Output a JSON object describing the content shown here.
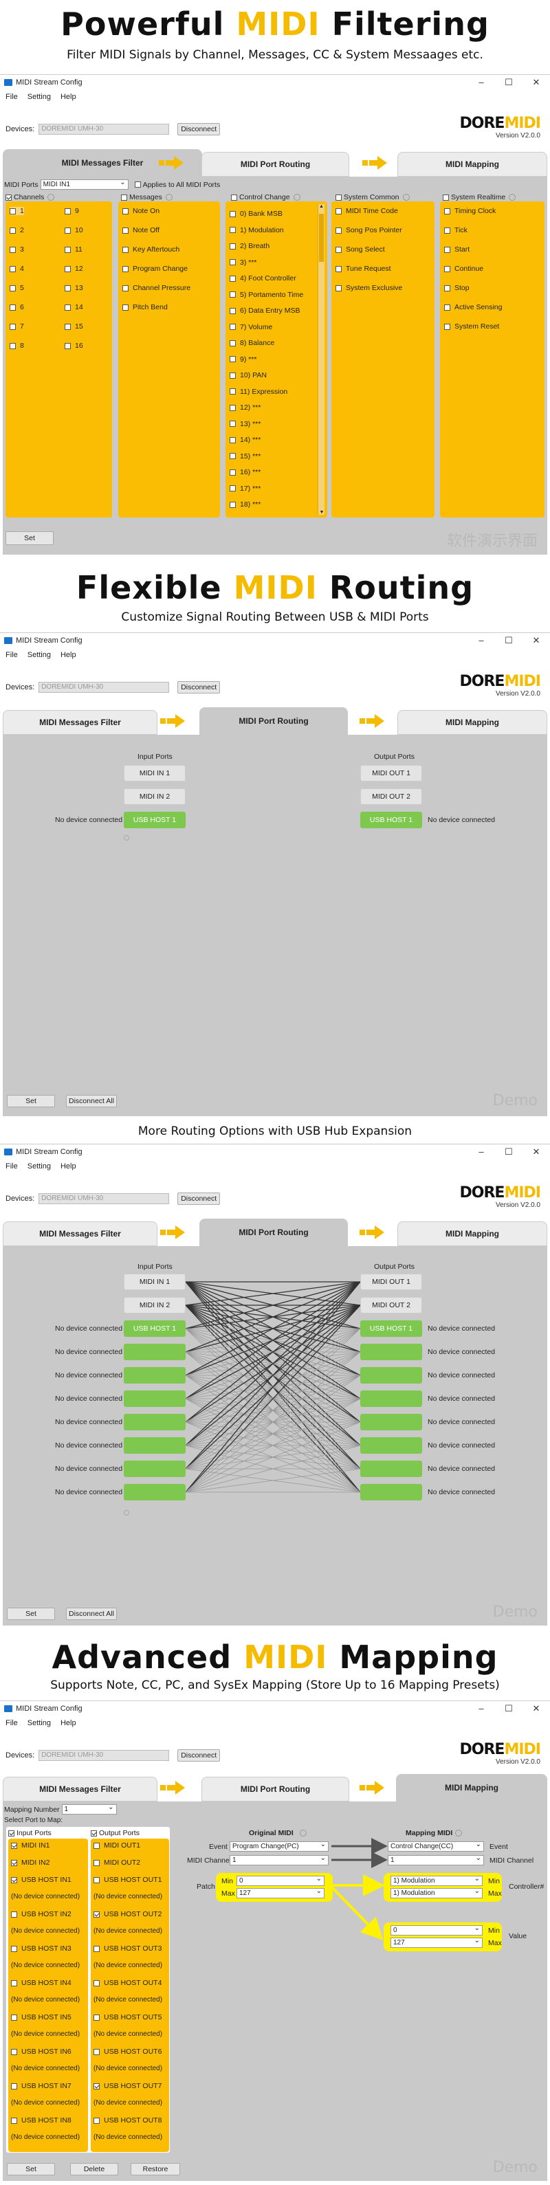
{
  "app": {
    "window_title": "MIDI Stream Config",
    "menu": [
      "File",
      "Setting",
      "Help"
    ],
    "devices_label": "Devices:",
    "device_name": "DOREMIDI UMH-30",
    "disconnect_label": "Disconnect",
    "logo_pre": "DORE",
    "logo_post": "MIDI",
    "version": "Version V2.0.0",
    "tabs": [
      "MIDI Messages Filter",
      "MIDI Port Routing",
      "MIDI Mapping"
    ]
  },
  "colors": {
    "accent": "#fbbd04",
    "green": "#7ec850",
    "yellow": "#fff200"
  },
  "section1": {
    "title_pre": "Powerful ",
    "title_hl": "MIDI",
    "title_post": " Filtering",
    "subtitle": "Filter MIDI Signals by Channel, Messages, CC & System Messaages etc.",
    "midi_ports_label": "MIDI Ports",
    "midi_ports_value": "MIDI IN1",
    "apply_all_label": "Applies to All MIDI Ports",
    "columns": {
      "channels": "Channels",
      "messages": "Messages",
      "control_change": "Control Change",
      "system_common": "System Common",
      "system_realtime": "System Realtime"
    },
    "channels": [
      "1",
      "2",
      "3",
      "4",
      "5",
      "6",
      "7",
      "8",
      "9",
      "10",
      "11",
      "12",
      "13",
      "14",
      "15",
      "16"
    ],
    "messages": [
      "Note On",
      "Note Off",
      "Key Aftertouch",
      "Program Change",
      "Channel Pressure",
      "Pitch Bend"
    ],
    "cc": [
      "0) Bank MSB",
      "1) Modulation",
      "2) Breath",
      "3) ***",
      "4) Foot Controller",
      "5) Portamento Time",
      "6) Data Entry MSB",
      "7) Volume",
      "8) Balance",
      "9) ***",
      "10) PAN",
      "11) Expression",
      "12) ***",
      "13) ***",
      "14) ***",
      "15) ***",
      "16) ***",
      "17) ***",
      "18) ***"
    ],
    "system_common": [
      "MIDI Time Code",
      "Song Pos Pointer",
      "Song Select",
      "Tune Request",
      "System Exclusive"
    ],
    "system_realtime": [
      "Timing Clock",
      "Tick",
      "Start",
      "Continue",
      "Stop",
      "Active Sensing",
      "System Reset"
    ],
    "set_label": "Set",
    "watermark": "软件演示界面"
  },
  "section2": {
    "title_pre": "Flexible ",
    "title_hl": "MIDI",
    "title_post": " Routing",
    "subtitle": "Customize Signal Routing Between USB & MIDI Ports",
    "input_ports_label": "Input Ports",
    "output_ports_label": "Output Ports",
    "inputs": [
      "MIDI IN 1",
      "MIDI IN 2",
      "USB HOST 1"
    ],
    "outputs": [
      "MIDI OUT 1",
      "MIDI OUT 2",
      "USB HOST 1"
    ],
    "no_device": "No device connected",
    "set_label": "Set",
    "disconnect_all_label": "Disconnect All",
    "watermark": "Demo"
  },
  "section3": {
    "heading": "More Routing Options with USB Hub Expansion",
    "input_ports_label": "Input Ports",
    "output_ports_label": "Output Ports",
    "inputs": [
      "MIDI IN 1",
      "MIDI IN 2",
      "USB HOST 1"
    ],
    "outputs": [
      "MIDI OUT 1",
      "MIDI OUT 2",
      "USB HOST 1"
    ],
    "no_device": "No device connected",
    "set_label": "Set",
    "disconnect_all_label": "Disconnect All",
    "watermark": "Demo"
  },
  "section4": {
    "title_pre": "Advanced ",
    "title_hl": "MIDI",
    "title_post": " Mapping",
    "subtitle": "Supports Note, CC, PC, and SysEx Mapping (Store Up to 16 Mapping Presets)",
    "mapping_number_label": "Mapping Number",
    "mapping_number_value": "1",
    "select_port_label": "Select Port to Map:",
    "input_ports_label": "Input Ports",
    "output_ports_label": "Output Ports",
    "input_list": [
      "MIDI IN1",
      "MIDI IN2",
      "USB HOST IN1",
      "(No device connected)",
      "USB HOST IN2",
      "(No device connected)",
      "USB HOST IN3",
      "(No device connected)",
      "USB HOST IN4",
      "(No device connected)",
      "USB HOST IN5",
      "(No device connected)",
      "USB HOST IN6",
      "(No device connected)",
      "USB HOST IN7",
      "(No device connected)",
      "USB HOST IN8",
      "(No device connected)"
    ],
    "output_list": [
      "MIDI OUT1",
      "MIDI OUT2",
      "USB HOST OUT1",
      "(No device connected)",
      "USB HOST OUT2",
      "(No device connected)",
      "USB HOST OUT3",
      "(No device connected)",
      "USB HOST OUT4",
      "(No device connected)",
      "USB HOST OUT5",
      "(No device connected)",
      "USB HOST OUT6",
      "(No device connected)",
      "USB HOST OUT7",
      "(No device connected)",
      "USB HOST OUT8",
      "(No device connected)"
    ],
    "original_midi_label": "Original MIDI",
    "mapping_midi_label": "Mapping MIDI",
    "event_label": "Event",
    "event_value": "Program Change(PC)",
    "map_event_value": "Control Change(CC)",
    "midi_channel_label": "MIDI Channel",
    "channel_value": "1",
    "map_channel_value": "1",
    "patch_label": "Patch",
    "min_label": "Min",
    "max_label": "Max",
    "patch_min": "0",
    "patch_max": "127",
    "ctrl_min": "1) Modulation",
    "ctrl_max": "1) Modulation",
    "controller_label": "Controller#",
    "value_min": "0",
    "value_max": "127",
    "value_label": "Value",
    "set_label": "Set",
    "delete_label": "Delete",
    "restore_label": "Restore",
    "watermark": "Demo"
  }
}
